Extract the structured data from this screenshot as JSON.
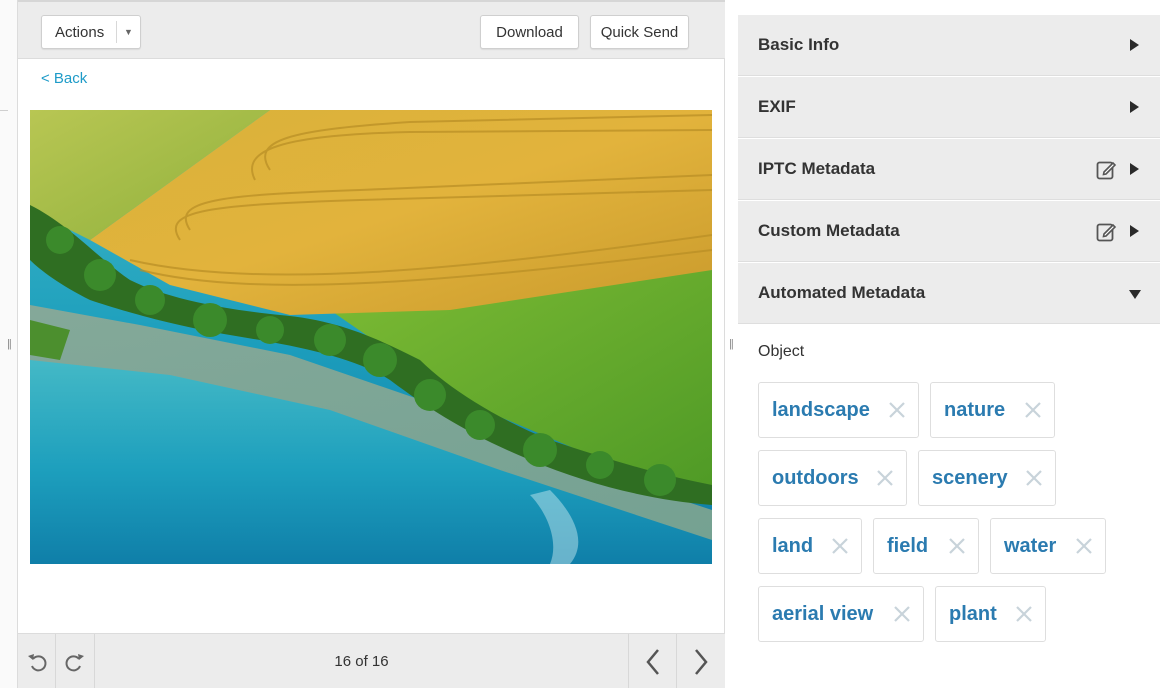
{
  "toolbar": {
    "actions_label": "Actions",
    "download_label": "Download",
    "quick_send_label": "Quick Send"
  },
  "viewer": {
    "back_label": "< Back",
    "counter": "16 of 16"
  },
  "panel": {
    "sections": [
      {
        "title": "Basic Info",
        "editable": false,
        "expanded": false
      },
      {
        "title": "EXIF",
        "editable": false,
        "expanded": false
      },
      {
        "title": "IPTC Metadata",
        "editable": true,
        "expanded": false
      },
      {
        "title": "Custom Metadata",
        "editable": true,
        "expanded": false
      },
      {
        "title": "Automated Metadata",
        "editable": false,
        "expanded": true
      }
    ],
    "object_label": "Object",
    "tags": [
      "landscape",
      "nature",
      "outdoors",
      "scenery",
      "land",
      "field",
      "water",
      "aerial view",
      "plant"
    ]
  },
  "colors": {
    "accent": "#1e9bc8",
    "tag_text": "#2b7bb0",
    "panel_header_bg": "#ececec"
  },
  "icons": [
    "chevron-down-icon",
    "rotate-left-icon",
    "rotate-right-icon",
    "chevron-left-icon",
    "chevron-right-icon",
    "edit-icon",
    "caret-right-icon",
    "caret-down-icon",
    "close-icon",
    "drag-handle-icon"
  ]
}
